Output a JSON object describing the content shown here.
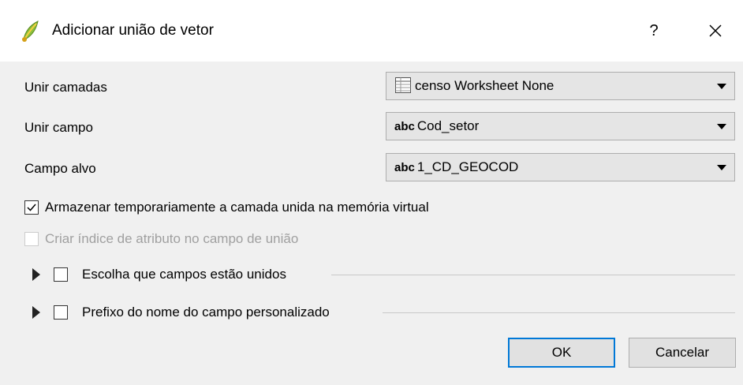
{
  "window": {
    "title": "Adicionar união de vetor",
    "help_label": "?"
  },
  "form": {
    "join_layer": {
      "label": "Unir camadas",
      "value": "censo Worksheet None",
      "icon": "table-icon"
    },
    "join_field": {
      "label": "Unir campo",
      "type_tag": "abc",
      "value": "Cod_setor"
    },
    "target_field": {
      "label": "Campo alvo",
      "type_tag": "abc",
      "value": "1_CD_GEOCOD"
    },
    "cache_option": {
      "label": "Armazenar temporariamente a camada unida na memória virtual",
      "checked": true
    },
    "index_option": {
      "label": "Criar índice de atributo no campo de união",
      "checked": false,
      "enabled": false
    },
    "joined_fields_group": {
      "label": "Escolha que campos estão unidos",
      "checked": false,
      "expanded": false
    },
    "prefix_group": {
      "label": "Prefixo do nome do campo personalizado",
      "checked": false,
      "expanded": false
    }
  },
  "buttons": {
    "ok": "OK",
    "cancel": "Cancelar"
  },
  "colors": {
    "accent": "#0078d7",
    "titlebar": "#ffffff",
    "background": "#f0f0f0"
  }
}
